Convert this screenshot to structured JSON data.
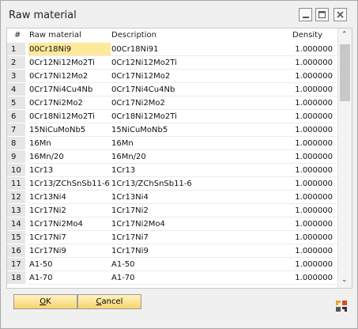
{
  "window": {
    "title": "Raw material"
  },
  "columns": {
    "num": "#",
    "code": "Raw material",
    "desc": "Description",
    "density": "Density"
  },
  "rows": [
    {
      "n": "1",
      "code": "00Cr18Ni9",
      "desc": "00Cr18Ni91",
      "density": "1.000000"
    },
    {
      "n": "2",
      "code": "0Cr12Ni12Mo2Ti",
      "desc": "0Cr12Ni12Mo2Ti",
      "density": "1.000000"
    },
    {
      "n": "3",
      "code": "0Cr17Ni12Mo2",
      "desc": "0Cr17Ni12Mo2",
      "density": "1.000000"
    },
    {
      "n": "4",
      "code": "0Cr17Ni4Cu4Nb",
      "desc": "0Cr17Ni4Cu4Nb",
      "density": "1.000000"
    },
    {
      "n": "5",
      "code": "0Cr17Ni2Mo2",
      "desc": "0Cr17Ni2Mo2",
      "density": "1.000000"
    },
    {
      "n": "6",
      "code": "0Cr18Ni12Mo2Ti",
      "desc": "0Cr18Ni12Mo2Ti",
      "density": "1.000000"
    },
    {
      "n": "7",
      "code": "15NiCuMoNb5",
      "desc": "15NiCuMoNb5",
      "density": "1.000000"
    },
    {
      "n": "8",
      "code": "16Mn",
      "desc": "16Mn",
      "density": "1.000000"
    },
    {
      "n": "9",
      "code": "16Mn/20",
      "desc": "16Mn/20",
      "density": "1.000000"
    },
    {
      "n": "10",
      "code": "1Cr13",
      "desc": "1Cr13",
      "density": "1.000000"
    },
    {
      "n": "11",
      "code": "1Cr13/ZChSnSb11-6",
      "desc": "1Cr13/ZChSnSb11-6",
      "density": "1.000000"
    },
    {
      "n": "12",
      "code": "1Cr13Ni4",
      "desc": "1Cr13Ni4",
      "density": "1.000000"
    },
    {
      "n": "13",
      "code": "1Cr17Ni2",
      "desc": "1Cr17Ni2",
      "density": "1.000000"
    },
    {
      "n": "14",
      "code": "1Cr17Ni2Mo4",
      "desc": "1Cr17Ni2Mo4",
      "density": "1.000000"
    },
    {
      "n": "15",
      "code": "1Cr17Ni7",
      "desc": "1Cr17Ni7",
      "density": "1.000000"
    },
    {
      "n": "16",
      "code": "1Cr17Ni9",
      "desc": "1Cr17Ni9",
      "density": "1.000000"
    },
    {
      "n": "17",
      "code": "A1-50",
      "desc": "A1-50",
      "density": "1.000000"
    },
    {
      "n": "18",
      "code": "A1-70",
      "desc": "A1-70",
      "density": "1.000000"
    }
  ],
  "buttons": {
    "ok_mnemonic": "O",
    "ok_rest": "K",
    "cancel_mnemonic": "C",
    "cancel_rest": "ancel"
  },
  "icons": {
    "minimize": "minimize-icon",
    "maximize": "maximize-icon",
    "close": "close-icon",
    "scroll_up": "chevron-up-icon",
    "scroll_down": "chevron-down-icon",
    "logo": "sap-logo-icon"
  },
  "colors": {
    "selected_cell": "#fee99b",
    "button_top": "#fff3c4",
    "button_bottom": "#f7d36b"
  }
}
